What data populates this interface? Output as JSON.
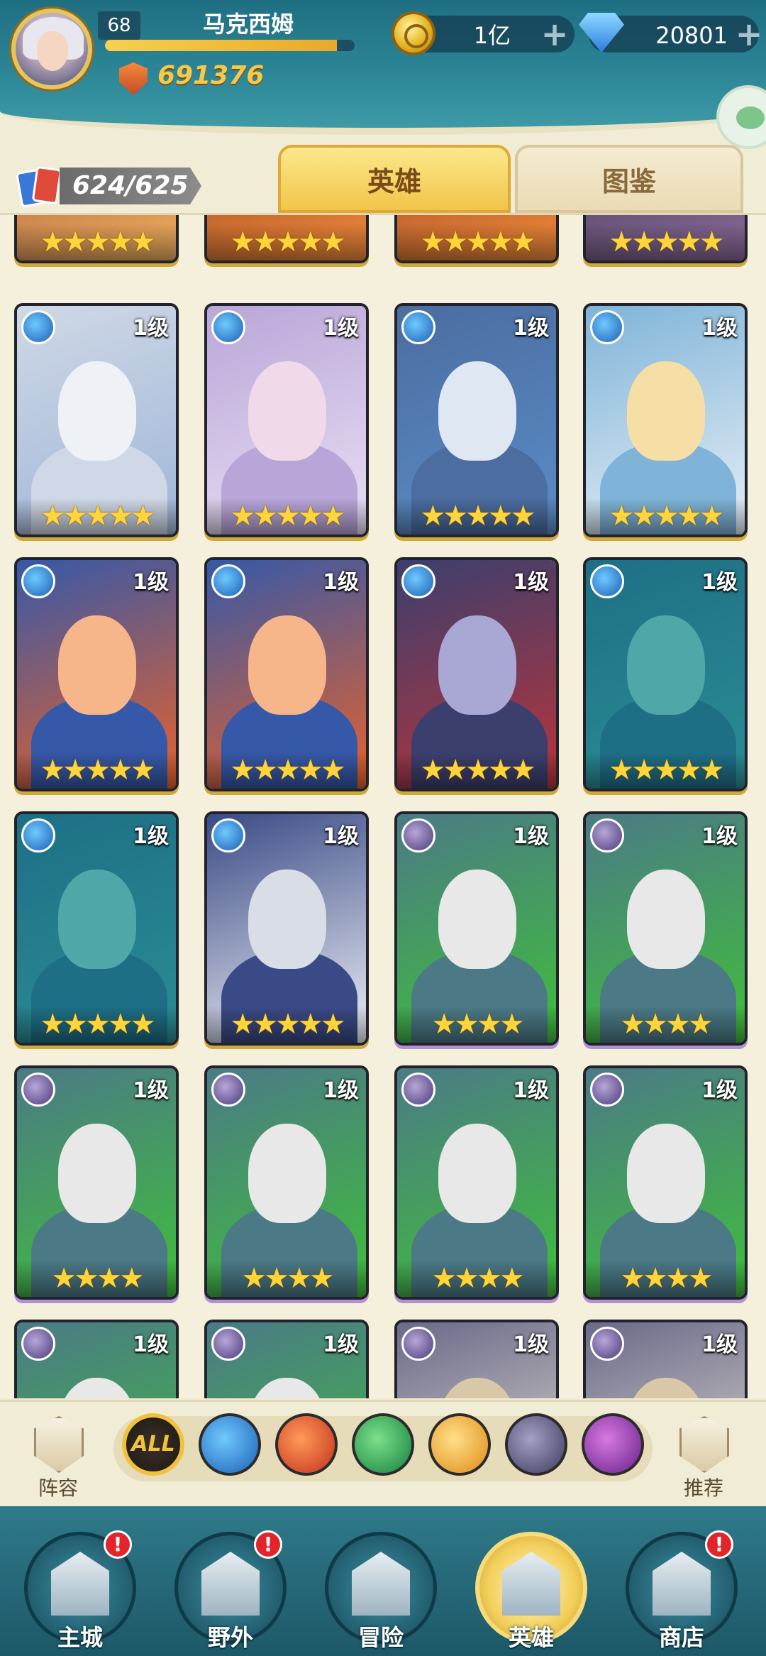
{
  "player": {
    "level": "68",
    "name": "马克西姆",
    "power": "691376",
    "xp_fraction": 0.93
  },
  "resources": {
    "gold": "1亿",
    "gems": "20801",
    "plus": "+"
  },
  "collection": {
    "count": "624/625"
  },
  "tabs": {
    "heroes": "英雄",
    "album": "图鉴"
  },
  "partial_top_row": [
    {
      "stars": "★★★★★",
      "theme": "warm"
    },
    {
      "stars": "★★★★★",
      "theme": "fire"
    },
    {
      "stars": "★★★★★",
      "theme": "fire"
    },
    {
      "stars": "★★★★★",
      "theme": "dark"
    }
  ],
  "heroes": [
    {
      "level": "1级",
      "stars": "★★★★★",
      "element": "water",
      "theme": "snow"
    },
    {
      "level": "1级",
      "stars": "★★★★★",
      "element": "water",
      "theme": "lilac"
    },
    {
      "level": "1级",
      "stars": "★★★★★",
      "element": "water",
      "theme": "ice"
    },
    {
      "level": "1级",
      "stars": "★★★★★",
      "element": "water",
      "theme": "sky"
    },
    {
      "level": "1级",
      "stars": "★★★★★",
      "element": "water",
      "theme": "flame-hair"
    },
    {
      "level": "1级",
      "stars": "★★★★★",
      "element": "water",
      "theme": "flame-hair"
    },
    {
      "level": "1级",
      "stars": "★★★★★",
      "element": "water",
      "theme": "night"
    },
    {
      "level": "1级",
      "stars": "★★★★★",
      "element": "water",
      "theme": "teal"
    },
    {
      "level": "1级",
      "stars": "★★★★★",
      "element": "water",
      "theme": "teal"
    },
    {
      "level": "1级",
      "stars": "★★★★★",
      "element": "water",
      "theme": "veil"
    },
    {
      "level": "1级",
      "stars": "★★★★",
      "element": "dark",
      "theme": "mech"
    },
    {
      "level": "1级",
      "stars": "★★★★",
      "element": "dark",
      "theme": "mech"
    },
    {
      "level": "1级",
      "stars": "★★★★",
      "element": "dark",
      "theme": "mech"
    },
    {
      "level": "1级",
      "stars": "★★★★",
      "element": "dark",
      "theme": "mech"
    },
    {
      "level": "1级",
      "stars": "★★★★",
      "element": "dark",
      "theme": "mech"
    },
    {
      "level": "1级",
      "stars": "★★★★",
      "element": "dark",
      "theme": "mech"
    },
    {
      "level": "1级",
      "stars": "",
      "element": "dark",
      "theme": "mech"
    },
    {
      "level": "1级",
      "stars": "",
      "element": "dark",
      "theme": "mech"
    },
    {
      "level": "1级",
      "stars": "",
      "element": "dark",
      "theme": "pale"
    },
    {
      "level": "1级",
      "stars": "",
      "element": "dark",
      "theme": "pale"
    }
  ],
  "filters": {
    "lineup": "阵容",
    "all": "ALL",
    "recommend": "推荐"
  },
  "nav": {
    "city": "主城",
    "wild": "野外",
    "adventure": "冒险",
    "heroes": "英雄",
    "shop": "商店",
    "badge": "!"
  },
  "colors": {
    "header": "#2b8596",
    "accent_gold": "#f1c54a",
    "star": "#ffd53a",
    "badge_red": "#e3242b"
  }
}
